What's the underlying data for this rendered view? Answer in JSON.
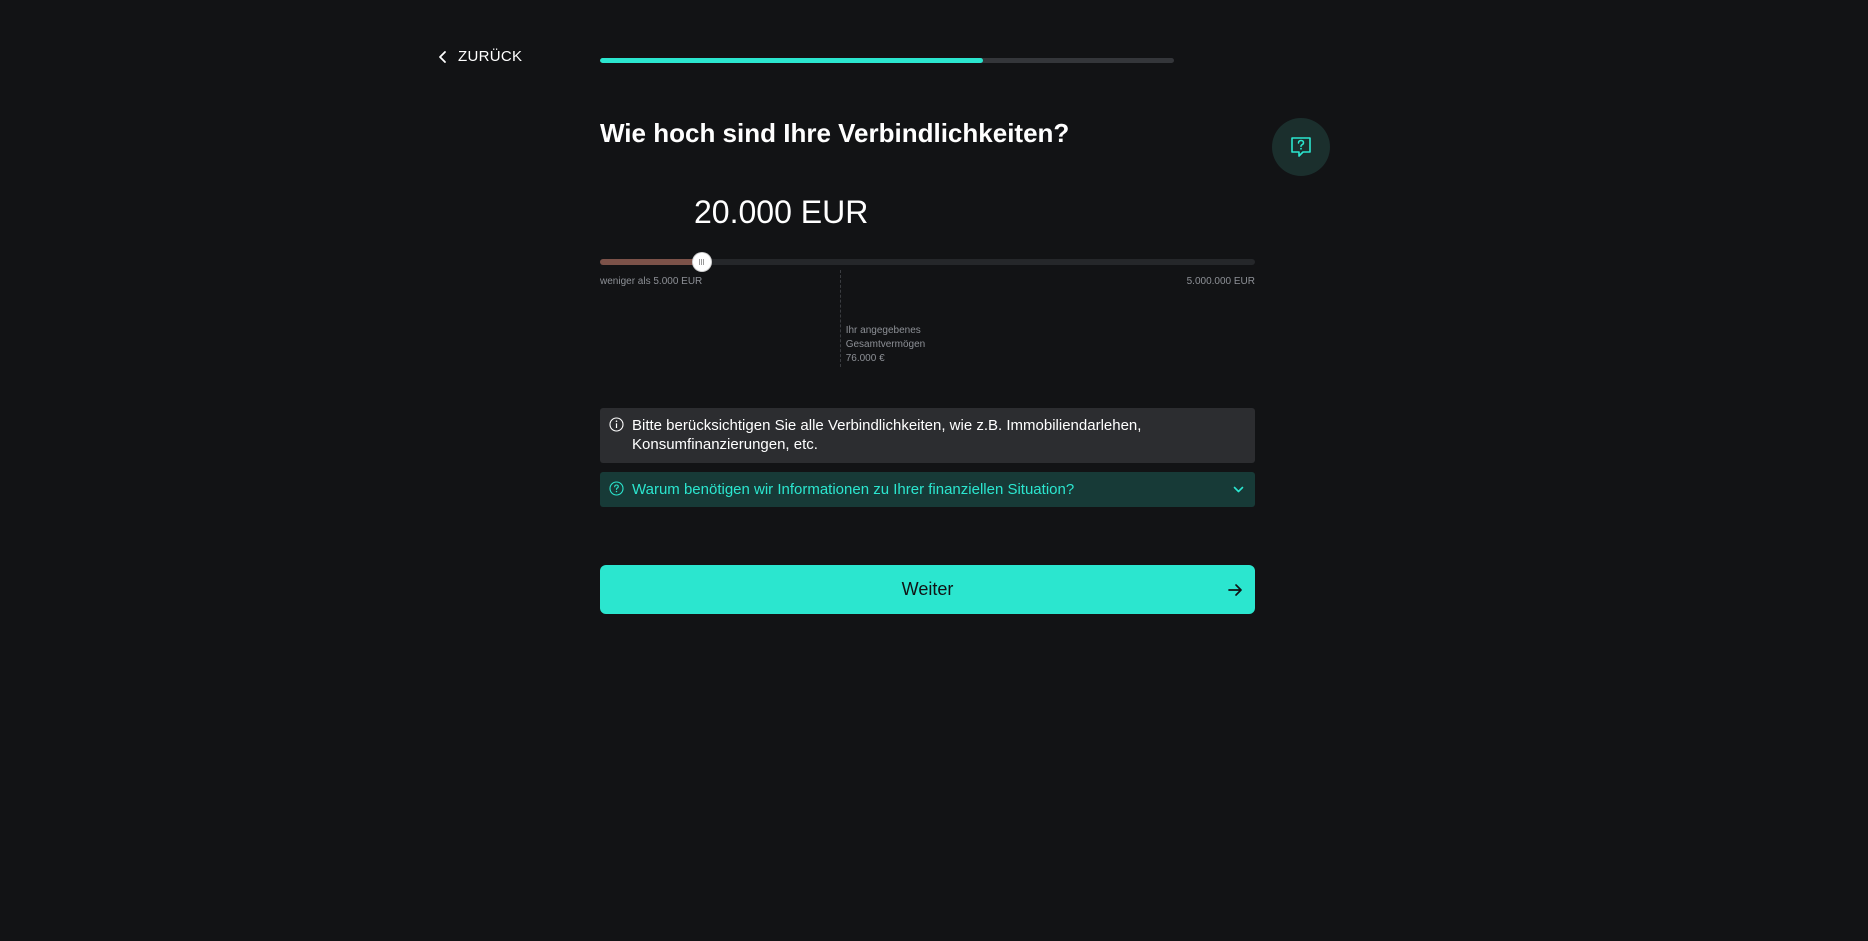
{
  "nav": {
    "back_label": "ZURÜCK"
  },
  "progress": {
    "value": 0.667
  },
  "question": {
    "title": "Wie hoch sind Ihre Verbindlichkeiten?",
    "value_display": "20.000 EUR"
  },
  "slider": {
    "value_fraction": 0.155,
    "min_label": "weniger als 5.000 EUR",
    "max_label": "5.000.000 EUR",
    "marker_fraction": 0.366,
    "marker_line1": "Ihr angegebenes",
    "marker_line2": "Gesamtvermögen",
    "marker_line3": "76.000 €"
  },
  "info": {
    "text": "Bitte berücksichtigen Sie alle Verbindlichkeiten, wie z.B. Immobiliendarlehen, Konsumfinanzierungen, etc."
  },
  "accordion": {
    "label": "Warum benötigen wir Informationen zu Ihrer finanziellen Situation?"
  },
  "cta": {
    "label": "Weiter"
  },
  "colors": {
    "background": "#121315",
    "accent": "#2be6cf",
    "slider_fill": "#7c5249",
    "info_bg": "#2c2d30",
    "accordion_bg": "#173a37"
  },
  "icons": {
    "back": "chevron-left-icon",
    "help": "question-chat-icon",
    "info": "info-circle-icon",
    "accordion": "question-circle-icon",
    "accordion_toggle": "chevron-down-icon",
    "cta": "arrow-right-icon"
  }
}
